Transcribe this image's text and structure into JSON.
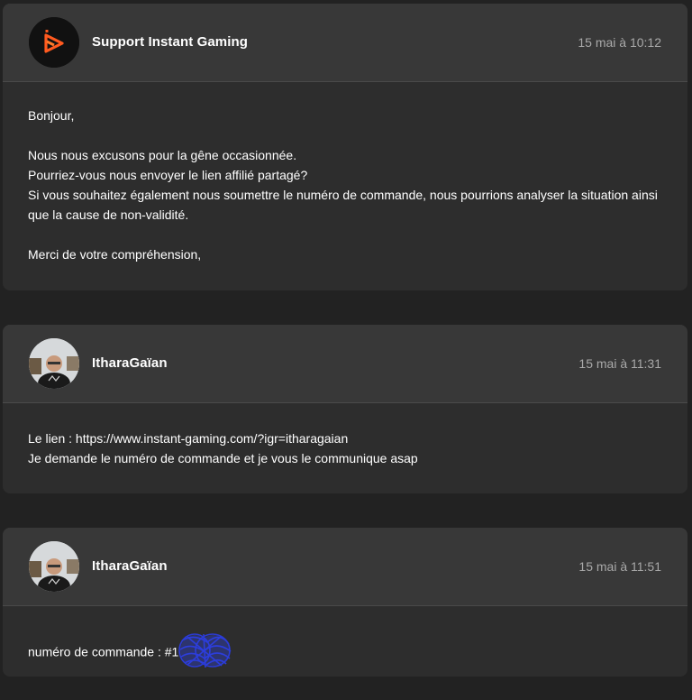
{
  "messages": [
    {
      "author": "Support Instant Gaming",
      "timestamp": "15 mai à 10:12",
      "avatar_icon": "instant-gaming-logo-icon",
      "lines": [
        "Bonjour,",
        "",
        "Nous nous excusons pour la gêne occasionnée.",
        "Pourriez-vous nous envoyer le lien affilié partagé?",
        "Si vous souhaitez également nous soumettre le numéro de commande, nous pourrions analyser la situation ainsi",
        "que la cause de non-validité.",
        "",
        "Merci de votre compréhension,"
      ]
    },
    {
      "author": "ItharaGaïan",
      "timestamp": "15 mai à 11:31",
      "avatar_icon": "user-photo-avatar",
      "lines": [
        "Le lien : https://www.instant-gaming.com/?igr=itharagaian",
        "Je demande le numéro de commande et je vous le communique asap"
      ]
    },
    {
      "author": "ItharaGaïan",
      "timestamp": "15 mai à 11:51",
      "avatar_icon": "user-photo-avatar",
      "lines": [
        "numéro de commande : #1"
      ],
      "redaction": "blue-scribble-redaction"
    }
  ],
  "colors": {
    "page_background": "#222222",
    "card_background": "#2d2d2d",
    "header_background": "#383838",
    "brand_orange": "#ff5a1f",
    "timestamp_gray": "#a9a9a9",
    "redaction_blue": "#2b3bd6"
  }
}
